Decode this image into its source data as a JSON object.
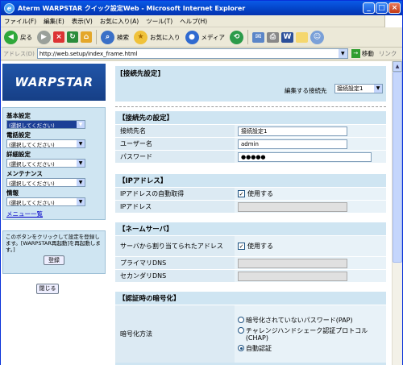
{
  "window": {
    "title": "Aterm WARPSTAR クイック設定Web - Microsoft Internet Explorer"
  },
  "menu": [
    "ファイル(F)",
    "編集(E)",
    "表示(V)",
    "お気に入り(A)",
    "ツール(T)",
    "ヘルプ(H)"
  ],
  "toolbar": {
    "back": "戻る",
    "search": "検索",
    "favorites": "お気に入り",
    "media": "メディア"
  },
  "address": {
    "label": "アドレス(D)",
    "url": "http://web.setup/index_frame.html",
    "go": "移動",
    "links": "リンク"
  },
  "sidebar": {
    "logo": "WARPSTAR",
    "groups": [
      {
        "heading": "基本設定",
        "value": "(選択してください)"
      },
      {
        "heading": "電話設定",
        "value": "(選択してください)"
      },
      {
        "heading": "詳細設定",
        "value": "(選択してください)"
      },
      {
        "heading": "メンテナンス",
        "value": "(選択してください)"
      },
      {
        "heading": "情報",
        "value": "(選択してください)"
      }
    ],
    "menu_list": "メニュー一覧",
    "help_text": "このボタンをクリックして設定を登録します。[WARPSTAR再起動]を再起動します。]",
    "register": "登録",
    "close": "閉じる"
  },
  "main": {
    "title": "[接続先設定]",
    "edit_label": "編集する接続先",
    "edit_value": "接続設定1",
    "connection": {
      "heading": "【接続先の設定】",
      "name_label": "接続先名",
      "name_value": "接続設定1",
      "user_label": "ユーザー名",
      "user_value": "admin",
      "pass_label": "パスワード",
      "pass_value": "●●●●●"
    },
    "ip": {
      "heading": "【IPアドレス】",
      "auto_label": "IPアドレスの自動取得",
      "auto_text": "使用する",
      "ip_label": "IPアドレス"
    },
    "dns": {
      "heading": "【ネームサーバ】",
      "assign_label": "サーバから割り当てられたアドレス",
      "assign_text": "使用する",
      "primary_label": "プライマリDNS",
      "secondary_label": "セカンダリDNS"
    },
    "auth": {
      "heading": "【認証時の暗号化】",
      "method_label": "暗号化方法",
      "options": [
        "暗号化されていないパスワード(PAP)",
        "チャレンジハンドシェーク認証プロトコル(CHAP)",
        "自動認証"
      ]
    }
  }
}
